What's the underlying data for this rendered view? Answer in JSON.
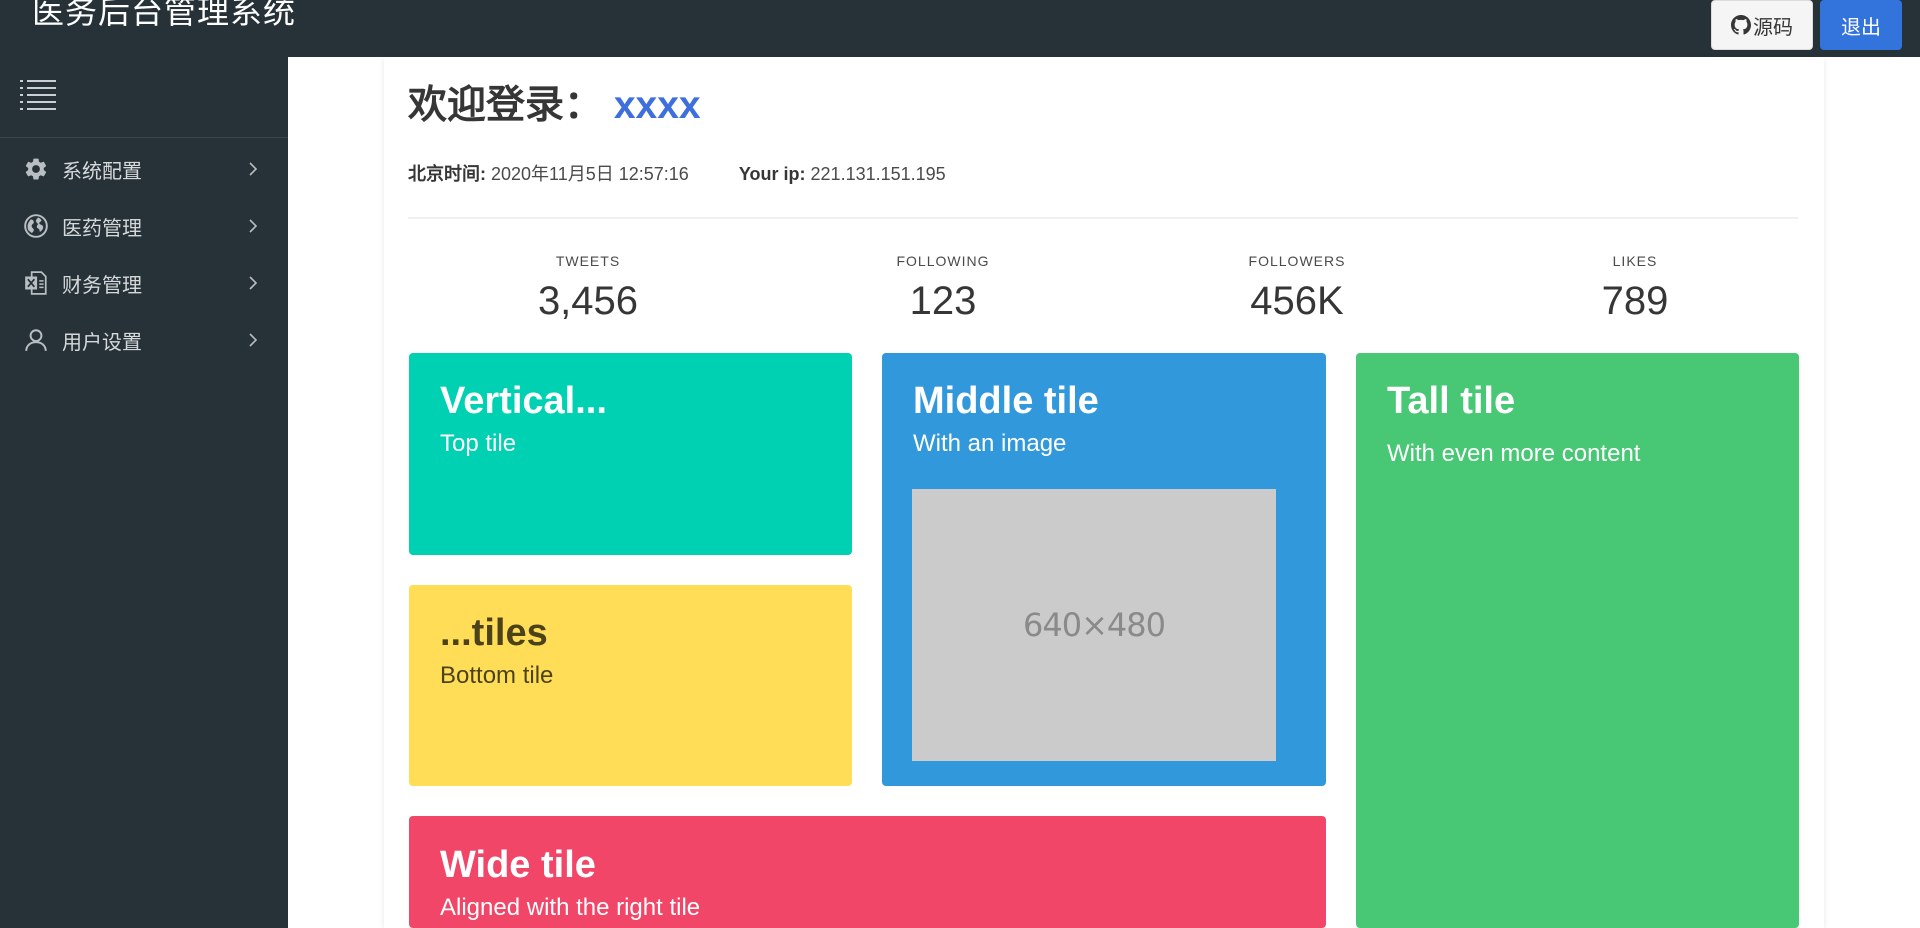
{
  "header": {
    "app_title": "医务后台管理系统",
    "source_button": "源码",
    "logout_button": "退出",
    "github_icon": "github-icon"
  },
  "sidebar": {
    "toggle_icon": "list-icon",
    "items": [
      {
        "label": "系统配置",
        "icon": "gear-icon"
      },
      {
        "label": "医药管理",
        "icon": "globe-icon"
      },
      {
        "label": "财务管理",
        "icon": "excel-file-icon"
      },
      {
        "label": "用户设置",
        "icon": "user-icon"
      }
    ]
  },
  "welcome": {
    "prefix": "欢迎登录：",
    "username": "xxxx"
  },
  "meta": {
    "time_label": "北京时间:",
    "time_value": "2020年11月5日 12:57:16",
    "ip_label": "Your ip:",
    "ip_value": "221.131.151.195"
  },
  "stats": [
    {
      "heading": "TWEETS",
      "value": "3,456"
    },
    {
      "heading": "FOLLOWING",
      "value": "123"
    },
    {
      "heading": "FOLLOWERS",
      "value": "456K"
    },
    {
      "heading": "LIKES",
      "value": "789"
    }
  ],
  "tiles": {
    "top": {
      "title": "Vertical...",
      "subtitle": "Top tile"
    },
    "bottom": {
      "title": "...tiles",
      "subtitle": "Bottom tile"
    },
    "middle": {
      "title": "Middle tile",
      "subtitle": "With an image",
      "image_text": "640×480"
    },
    "tall": {
      "title": "Tall tile",
      "subtitle": "With even more content"
    },
    "wide": {
      "title": "Wide tile",
      "subtitle": "Aligned with the right tile"
    }
  },
  "colors": {
    "topbar": "#263238",
    "accent_blue": "#3273dc",
    "turquoise": "#00d1b2",
    "yellow": "#ffdd57",
    "info": "#3298dc",
    "success": "#48c774",
    "danger": "#f14668"
  }
}
